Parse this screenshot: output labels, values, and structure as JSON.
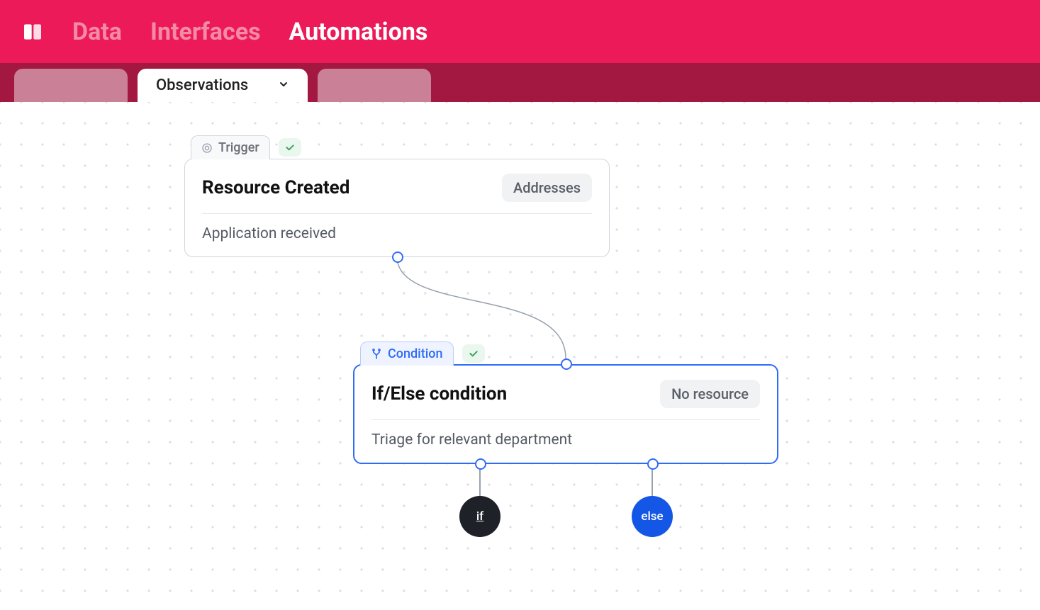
{
  "header": {
    "nav": {
      "data": "Data",
      "interfaces": "Interfaces",
      "automations": "Automations"
    }
  },
  "subheader": {
    "activeTab": "Observations"
  },
  "nodes": {
    "trigger": {
      "tabLabel": "Trigger",
      "title": "Resource Created",
      "badge": "Addresses",
      "description": "Application received"
    },
    "condition": {
      "tabLabel": "Condition",
      "title": "If/Else condition",
      "badge": "No resource",
      "description": "Triage for relevant department",
      "branches": {
        "if": "if",
        "else": "else"
      }
    }
  }
}
